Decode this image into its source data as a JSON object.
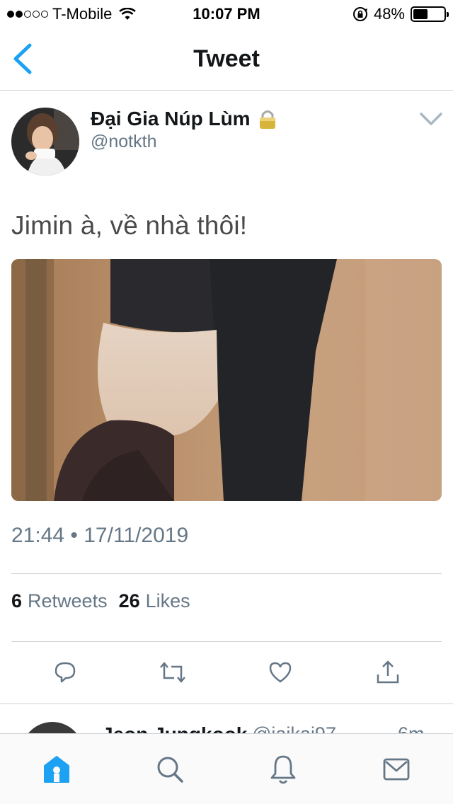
{
  "status_bar": {
    "carrier": "T-Mobile",
    "time": "10:07 PM",
    "battery_percent": "48%",
    "battery_level": 0.48,
    "signal_bars_filled": 2,
    "signal_bars_total": 5
  },
  "nav": {
    "title": "Tweet",
    "back_icon": "chevron-left-icon",
    "accent_color": "#1da1f2"
  },
  "tweet": {
    "display_name": "Đại Gia Núp Lùm",
    "handle": "@notkth",
    "protected_icon": "lock-icon",
    "text": "Jimin à, về nhà thôi!",
    "timestamp": "21:44 • 17/11/2019",
    "retweets_count": "6",
    "retweets_label": "Retweets",
    "likes_count": "26",
    "likes_label": "Likes"
  },
  "actions": [
    {
      "name": "reply-icon"
    },
    {
      "name": "retweet-icon"
    },
    {
      "name": "like-icon"
    },
    {
      "name": "share-icon"
    }
  ],
  "reply_preview": {
    "name": "Jeon Jungkook",
    "handle": "@jaikai97",
    "time": "6m"
  },
  "tab_bar": {
    "items": [
      {
        "icon": "home-icon",
        "active": true
      },
      {
        "icon": "search-icon",
        "active": false
      },
      {
        "icon": "notifications-icon",
        "active": false
      },
      {
        "icon": "messages-icon",
        "active": false
      }
    ]
  }
}
